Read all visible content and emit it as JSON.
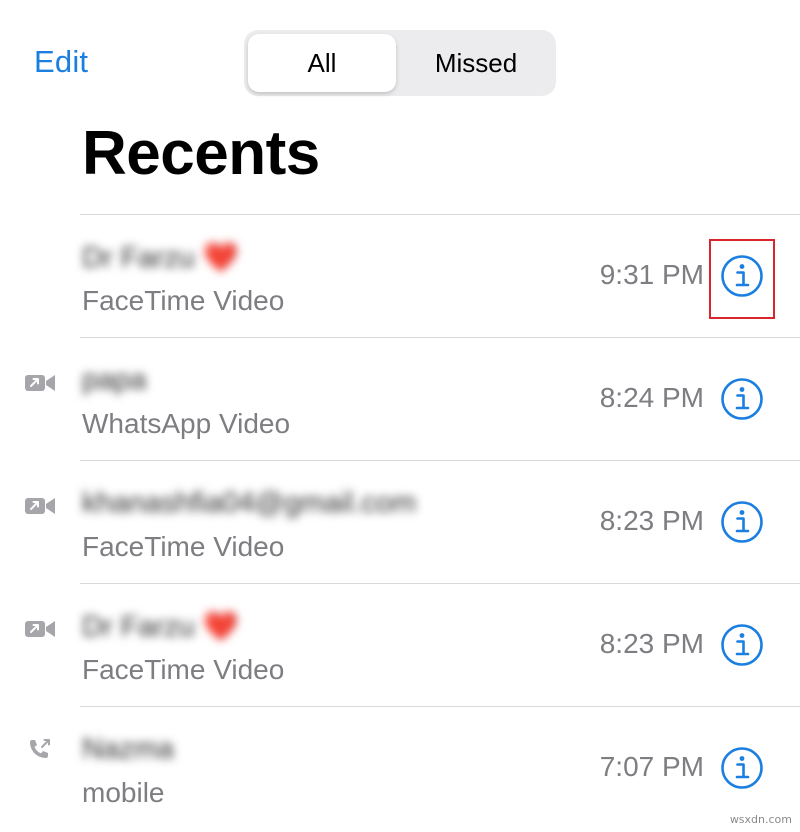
{
  "header": {
    "edit_label": "Edit",
    "segments": [
      {
        "label": "All",
        "selected": true
      },
      {
        "label": "Missed",
        "selected": false
      }
    ],
    "title": "Recents"
  },
  "colors": {
    "accent": "#1a7fe0",
    "secondary_text": "#7d7d82",
    "separator": "#d9d9dc",
    "highlight_box": "#d9262c",
    "heart": "#e02424"
  },
  "calls": [
    {
      "name": "Dr Farzu",
      "emoji": "❤️",
      "subtitle": "FaceTime Video",
      "time": "9:31 PM",
      "call_type_icon": "",
      "highlighted": true
    },
    {
      "name": "papa",
      "emoji": "",
      "subtitle": "WhatsApp Video",
      "time": "8:24 PM",
      "call_type_icon": "outgoing-video-icon",
      "highlighted": false
    },
    {
      "name": "khanashfia04@gmail.com",
      "emoji": "",
      "subtitle": "FaceTime Video",
      "time": "8:23 PM",
      "call_type_icon": "outgoing-video-icon",
      "highlighted": false
    },
    {
      "name": "Dr Farzu",
      "emoji": "❤️",
      "subtitle": "FaceTime Video",
      "time": "8:23 PM",
      "call_type_icon": "outgoing-video-icon",
      "highlighted": false
    },
    {
      "name": "Nazma",
      "emoji": "",
      "subtitle": "mobile",
      "time": "7:07 PM",
      "call_type_icon": "outgoing-phone-icon",
      "highlighted": false
    }
  ],
  "info_icon": "info-circle-icon",
  "watermark": "wsxdn.com"
}
